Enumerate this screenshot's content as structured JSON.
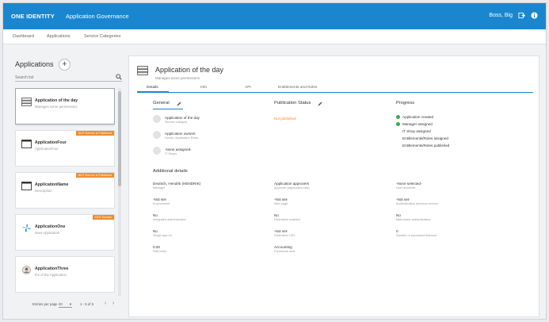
{
  "header": {
    "brand": "ONE IDENTITY",
    "app_title": "Application Governance",
    "user": "Boss, Big"
  },
  "subnav": [
    "Dashboard",
    "Applications",
    "Service Categories"
  ],
  "left_panel": {
    "title": "Applications",
    "add_label": "+",
    "search_placeholder": "Search list",
    "items": [
      {
        "name": "Application of the day",
        "desc": "Manages some permissions",
        "badge": ""
      },
      {
        "name": "ApplicationFour",
        "desc": "ApplicationFour",
        "badge": "NOT Earnes & Published"
      },
      {
        "name": "ApplicationName",
        "desc": "Description",
        "badge": "NOT Earnes & Published"
      },
      {
        "name": "ApplicationOne",
        "desc": "www Application",
        "badge": "NOT Earnes"
      },
      {
        "name": "ApplicationThree",
        "desc": "the of the Application",
        "badge": ""
      }
    ],
    "pager": {
      "label": "Entries per page",
      "size": "20",
      "range": "1 - 5 of 5",
      "prev": "‹",
      "next": "›"
    }
  },
  "detail": {
    "title": "Application of the day",
    "subtitle": "Manages some permissions",
    "tabs": [
      "Details",
      "Info",
      "API",
      "Entitlements and Roles"
    ],
    "general": {
      "title": "General",
      "rows": [
        {
          "label": "Application of the day",
          "sub": "Service category"
        },
        {
          "label": "Application owners",
          "sub": "Owner: Application Roles"
        },
        {
          "label": "-None assigned-",
          "sub": "IT Shops"
        }
      ]
    },
    "publication": {
      "title": "Publication Status",
      "status": "Not published"
    },
    "progress": {
      "title": "Progress",
      "items": [
        {
          "label": "Application created",
          "done": true
        },
        {
          "label": "Manager assigned",
          "done": true
        },
        {
          "label": "IT Shop assigned",
          "done": false
        },
        {
          "label": "Entitlements/Roles assigned",
          "done": false
        },
        {
          "label": "Entitlements/Roles published",
          "done": false
        }
      ]
    },
    "additional": {
      "title": "Additional details",
      "cells": [
        {
          "value": "Deutsch, Hendrik (HENDRIK)",
          "label": "Manager"
        },
        {
          "value": "Application approvers",
          "label": "Approver (application role)"
        },
        {
          "value": "-None selected-",
          "label": "User accounts"
        },
        {
          "value": "-Not set-",
          "label": "Environment"
        },
        {
          "value": "-Not set-",
          "label": "Web page"
        },
        {
          "value": "-Not set-",
          "label": "Authentication directory service"
        },
        {
          "value": "No",
          "label": "Integrated authentication"
        },
        {
          "value": "No",
          "label": "Federation enabled"
        },
        {
          "value": "No",
          "label": "Multi-factor authentication"
        },
        {
          "value": "No",
          "label": "Single sign on"
        },
        {
          "value": "-Not set-",
          "label": "Federation URL"
        },
        {
          "value": "0",
          "label": "Number of purchased licenses"
        },
        {
          "value": "0.00",
          "label": "Risk index"
        },
        {
          "value": "Accounting",
          "label": "Functional area"
        }
      ]
    }
  },
  "colors": {
    "accent": "#1a86cf",
    "badge": "#f08c2e",
    "success": "#3ca84a"
  }
}
